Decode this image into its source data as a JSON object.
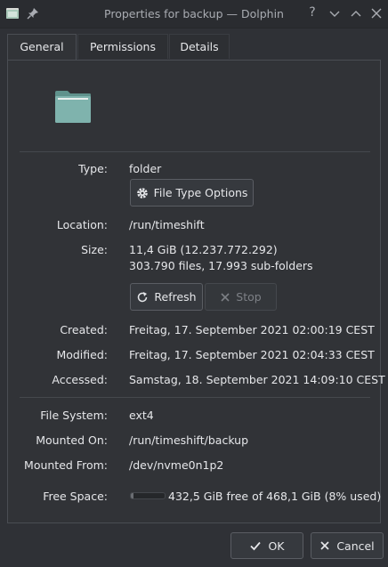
{
  "window": {
    "title": "Properties for backup — Dolphin",
    "help_glyph": "?"
  },
  "tabs": [
    {
      "label": "General",
      "active": true
    },
    {
      "label": "Permissions",
      "active": false
    },
    {
      "label": "Details",
      "active": false
    }
  ],
  "general": {
    "type": {
      "label": "Type:",
      "value": "folder"
    },
    "file_type_options_label": "File Type Options",
    "location": {
      "label": "Location:",
      "value": "/run/timeshift"
    },
    "size": {
      "label": "Size:",
      "value": "11,4 GiB (12.237.772.292)",
      "detail": "303.790 files, 17.993 sub-folders"
    },
    "refresh_label": "Refresh",
    "stop_label": "Stop",
    "created": {
      "label": "Created:",
      "value": "Freitag, 17. September 2021 02:00:19 CEST"
    },
    "modified": {
      "label": "Modified:",
      "value": "Freitag, 17. September 2021 02:04:33 CEST"
    },
    "accessed": {
      "label": "Accessed:",
      "value": "Samstag, 18. September 2021 14:09:10 CEST"
    },
    "file_system": {
      "label": "File System:",
      "value": "ext4"
    },
    "mounted_on": {
      "label": "Mounted On:",
      "value": "/run/timeshift/backup"
    },
    "mounted_from": {
      "label": "Mounted From:",
      "value": "/dev/nvme0n1p2"
    },
    "free_space": {
      "label": "Free Space:",
      "value": "432,5 GiB free of 468,1 GiB (8% used)",
      "used_fraction": 0.08
    }
  },
  "dialog": {
    "ok_label": "OK",
    "cancel_label": "Cancel"
  },
  "icons": {
    "app": "dolphin-folder-icon",
    "pin": "pin-icon",
    "folder": "folder-icon",
    "gear": "gear-icon",
    "refresh": "refresh-icon",
    "stop": "stop-icon",
    "ok": "check-icon",
    "cancel": "close-icon"
  },
  "colors": {
    "background": "#2f3136",
    "panel": "#313337",
    "folder": "#7fb3ad",
    "text": "#e6e7ea"
  }
}
